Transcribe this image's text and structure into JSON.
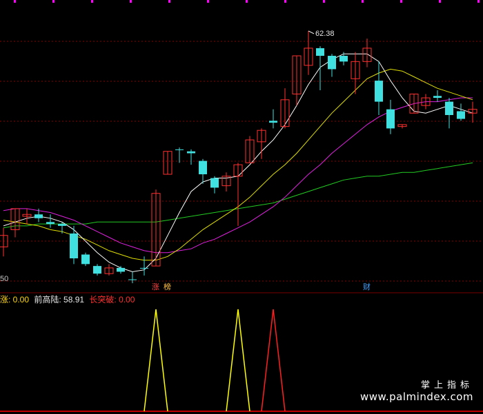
{
  "chart_data": {
    "type": "candlestick",
    "price_range": [
      49.5,
      63.2
    ],
    "candles": [
      {
        "o": 51.0,
        "h": 52.0,
        "l": 50.5,
        "c": 51.6,
        "up": true
      },
      {
        "o": 51.9,
        "h": 53.0,
        "l": 51.5,
        "c": 53.0,
        "up": true
      },
      {
        "o": 52.6,
        "h": 53.0,
        "l": 52.2,
        "c": 52.7,
        "up": true
      },
      {
        "o": 52.7,
        "h": 53.0,
        "l": 52.3,
        "c": 52.5,
        "up": false
      },
      {
        "o": 52.3,
        "h": 52.7,
        "l": 52.0,
        "c": 52.2,
        "up": false
      },
      {
        "o": 52.2,
        "h": 52.3,
        "l": 51.7,
        "c": 52.1,
        "up": false
      },
      {
        "o": 51.7,
        "h": 52.1,
        "l": 50.1,
        "c": 50.4,
        "up": false
      },
      {
        "o": 50.6,
        "h": 50.7,
        "l": 50.0,
        "c": 50.1,
        "up": false
      },
      {
        "o": 50.0,
        "h": 50.1,
        "l": 49.5,
        "c": 49.6,
        "up": false
      },
      {
        "o": 49.6,
        "h": 50.1,
        "l": 49.5,
        "c": 49.9,
        "up": true
      },
      {
        "o": 49.9,
        "h": 50.0,
        "l": 49.6,
        "c": 49.7,
        "up": false
      },
      {
        "o": 49.3,
        "h": 49.7,
        "l": 49.1,
        "c": 49.3,
        "up": false
      },
      {
        "o": 49.9,
        "h": 50.5,
        "l": 49.5,
        "c": 49.9,
        "up": false
      },
      {
        "o": 50.0,
        "h": 54.0,
        "l": 50.0,
        "c": 53.8,
        "up": true
      },
      {
        "o": 54.8,
        "h": 56.0,
        "l": 54.8,
        "c": 56.0,
        "up": true
      },
      {
        "o": 56.1,
        "h": 56.2,
        "l": 55.4,
        "c": 56.1,
        "up": false
      },
      {
        "o": 56.0,
        "h": 56.1,
        "l": 55.3,
        "c": 55.9,
        "up": false
      },
      {
        "o": 55.5,
        "h": 55.6,
        "l": 54.3,
        "c": 54.8,
        "up": false
      },
      {
        "o": 54.6,
        "h": 54.7,
        "l": 53.8,
        "c": 54.1,
        "up": false
      },
      {
        "o": 54.2,
        "h": 54.9,
        "l": 53.9,
        "c": 54.7,
        "up": true
      },
      {
        "o": 54.7,
        "h": 55.4,
        "l": 52.1,
        "c": 55.3,
        "up": true
      },
      {
        "o": 55.4,
        "h": 56.8,
        "l": 55.4,
        "c": 56.6,
        "up": true
      },
      {
        "o": 56.5,
        "h": 57.2,
        "l": 55.6,
        "c": 57.1,
        "up": true
      },
      {
        "o": 57.5,
        "h": 58.2,
        "l": 57.2,
        "c": 57.6,
        "up": false
      },
      {
        "o": 57.3,
        "h": 59.3,
        "l": 57.2,
        "c": 58.7,
        "up": true
      },
      {
        "o": 59.0,
        "h": 61.0,
        "l": 58.4,
        "c": 61.0,
        "up": true
      },
      {
        "o": 60.5,
        "h": 62.3,
        "l": 60.0,
        "c": 61.4,
        "up": true
      },
      {
        "o": 61.4,
        "h": 61.5,
        "l": 59.2,
        "c": 61.0,
        "up": false
      },
      {
        "o": 61.0,
        "h": 61.1,
        "l": 59.9,
        "c": 60.3,
        "up": false
      },
      {
        "o": 61.0,
        "h": 61.2,
        "l": 60.5,
        "c": 60.7,
        "up": false
      },
      {
        "o": 59.8,
        "h": 61.2,
        "l": 59.0,
        "c": 60.7,
        "up": true
      },
      {
        "o": 60.7,
        "h": 61.9,
        "l": 60.4,
        "c": 61.4,
        "up": true
      },
      {
        "o": 59.7,
        "h": 60.7,
        "l": 57.9,
        "c": 58.6,
        "up": false
      },
      {
        "o": 58.2,
        "h": 58.7,
        "l": 56.9,
        "c": 57.2,
        "up": false
      },
      {
        "o": 57.3,
        "h": 57.4,
        "l": 57.2,
        "c": 57.4,
        "up": true
      },
      {
        "o": 58.0,
        "h": 59.0,
        "l": 58.0,
        "c": 59.0,
        "up": true
      },
      {
        "o": 58.4,
        "h": 59.0,
        "l": 58.2,
        "c": 58.8,
        "up": true
      },
      {
        "o": 58.8,
        "h": 59.2,
        "l": 58.6,
        "c": 58.9,
        "up": false
      },
      {
        "o": 58.6,
        "h": 58.8,
        "l": 57.2,
        "c": 57.9,
        "up": false
      },
      {
        "o": 58.1,
        "h": 58.5,
        "l": 57.6,
        "c": 57.7,
        "up": false
      },
      {
        "o": 58.0,
        "h": 58.6,
        "l": 57.5,
        "c": 58.2,
        "up": true
      }
    ],
    "ma_white": [
      52.1,
      52.3,
      52.5,
      52.6,
      52.5,
      52.3,
      51.9,
      51.3,
      50.7,
      50.2,
      49.9,
      49.7,
      49.8,
      50.4,
      51.6,
      52.8,
      53.9,
      54.4,
      54.6,
      54.6,
      54.7,
      55.3,
      56.0,
      56.6,
      57.4,
      58.4,
      59.5,
      60.4,
      60.8,
      61.1,
      61.1,
      61.1,
      60.7,
      59.7,
      58.8,
      58.1,
      58.0,
      58.2,
      58.4,
      58.2,
      58.0
    ],
    "ma_yellow": [
      52.4,
      52.3,
      52.2,
      52.1,
      51.9,
      51.8,
      51.6,
      51.4,
      51.1,
      50.8,
      50.6,
      50.4,
      50.3,
      50.3,
      50.5,
      50.9,
      51.4,
      51.9,
      52.3,
      52.7,
      53.1,
      53.6,
      54.2,
      54.8,
      55.3,
      55.9,
      56.6,
      57.3,
      58.0,
      58.6,
      59.2,
      59.8,
      60.1,
      60.3,
      60.2,
      59.9,
      59.6,
      59.3,
      59.1,
      58.9,
      58.7
    ],
    "ma_magenta": [
      52.9,
      53.0,
      53.0,
      52.9,
      52.8,
      52.6,
      52.4,
      52.1,
      51.8,
      51.5,
      51.2,
      51.0,
      50.8,
      50.7,
      50.7,
      50.8,
      50.9,
      51.2,
      51.4,
      51.7,
      52.0,
      52.3,
      52.7,
      53.1,
      53.6,
      54.2,
      54.8,
      55.3,
      55.9,
      56.4,
      56.9,
      57.4,
      57.8,
      58.1,
      58.3,
      58.5,
      58.6,
      58.6,
      58.7,
      58.8,
      58.8
    ],
    "ma_green": [
      52.0,
      52.1,
      52.1,
      52.2,
      52.2,
      52.2,
      52.2,
      52.2,
      52.3,
      52.3,
      52.3,
      52.3,
      52.3,
      52.3,
      52.4,
      52.5,
      52.6,
      52.7,
      52.8,
      52.9,
      53.0,
      53.1,
      53.2,
      53.3,
      53.5,
      53.7,
      53.9,
      54.1,
      54.3,
      54.5,
      54.6,
      54.7,
      54.7,
      54.8,
      54.9,
      54.9,
      55.0,
      55.1,
      55.2,
      55.3,
      55.4
    ],
    "peak_label": "62.38",
    "low_label": "50",
    "badges": [
      {
        "text": "涨",
        "color": "#ff4040",
        "index": 13
      },
      {
        "text": "榜",
        "color": "#ffc040",
        "index": 14
      },
      {
        "text": "财",
        "color": "#40a0ff",
        "index": 31
      }
    ],
    "indicator": {
      "signals": [
        {
          "index": 13,
          "color": "#ffff00",
          "value": 1
        },
        {
          "index": 20,
          "color": "#ffff00",
          "value": 1
        },
        {
          "index": 23,
          "color": "#ff2020",
          "value": 1
        }
      ]
    }
  },
  "info": {
    "item1": "涨: 0.00",
    "item2": "前高陆: 58.91",
    "item3": "长突破: 0.00"
  },
  "watermark": {
    "cn": "掌上指标",
    "url": "www.palmindex.com"
  }
}
